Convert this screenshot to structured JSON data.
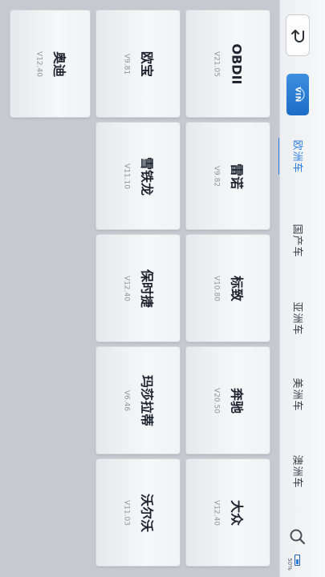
{
  "sidebar": {
    "vin_label": "VIN",
    "tabs": [
      {
        "label": "欧洲车",
        "active": true
      },
      {
        "label": "国产车",
        "active": false
      },
      {
        "label": "亚洲车",
        "active": false
      },
      {
        "label": "美洲车",
        "active": false
      },
      {
        "label": "澳洲车",
        "active": false
      }
    ],
    "battery": "50%",
    "accent": "#2a7de0"
  },
  "cards": [
    {
      "name": "OBDII",
      "version": "V21.05"
    },
    {
      "name": "雷诺",
      "version": "V9.82"
    },
    {
      "name": "标致",
      "version": "V10.80"
    },
    {
      "name": "奔驰",
      "version": "V20.50"
    },
    {
      "name": "大众",
      "version": "V12.40"
    },
    {
      "name": "欧宝",
      "version": "V9.81"
    },
    {
      "name": "雪铁龙",
      "version": "V11.10"
    },
    {
      "name": "保时捷",
      "version": "V12.40"
    },
    {
      "name": "玛莎拉蒂",
      "version": "V6.46"
    },
    {
      "name": "沃尔沃",
      "version": "V11.03"
    },
    {
      "name": "奥迪",
      "version": "V12.40"
    }
  ]
}
